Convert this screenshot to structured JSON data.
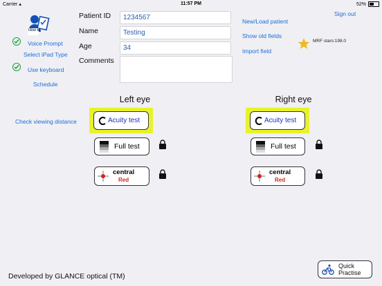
{
  "status": {
    "carrier": "Carrier",
    "time": "11:57 PM",
    "battery": "52%"
  },
  "logo": {
    "text": "How to"
  },
  "left": {
    "voice_prompt": "Voice Prompt",
    "select_ipad": "Select iPad Type",
    "use_keyboard": "Use keyboard",
    "schedule": "Schedule",
    "check_distance": "Check viewing distance"
  },
  "form": {
    "patient_id_label": "Patient ID",
    "patient_id_value": "1234567",
    "name_label": "Name",
    "name_value": "Testing",
    "age_label": "Age",
    "age_value": "34",
    "comments_label": "Comments",
    "comments_value": ""
  },
  "right": {
    "new_load": "New/Load patient",
    "show_old": "Show old fields",
    "import": "Import field",
    "sign_out": "Sign out",
    "mrf": "MRF stars:198.0"
  },
  "eyes": {
    "left": {
      "title": "Left eye",
      "acuity": "Acuity test",
      "full": "Full test",
      "central": "central",
      "central_color": "Red"
    },
    "right": {
      "title": "Right eye",
      "acuity": "Acuity test",
      "full": "Full test",
      "central": "central",
      "central_color": "Red"
    }
  },
  "footer": {
    "developer": "Developed by GLANCE optical (TM)",
    "quick_line1": "Quick",
    "quick_line2": "Practise"
  },
  "colors": {
    "link": "#1a6ed8",
    "check": "#1e9e3e",
    "highlight": "#e7f22a",
    "red": "#d8231c",
    "star": "#f3b81e"
  }
}
